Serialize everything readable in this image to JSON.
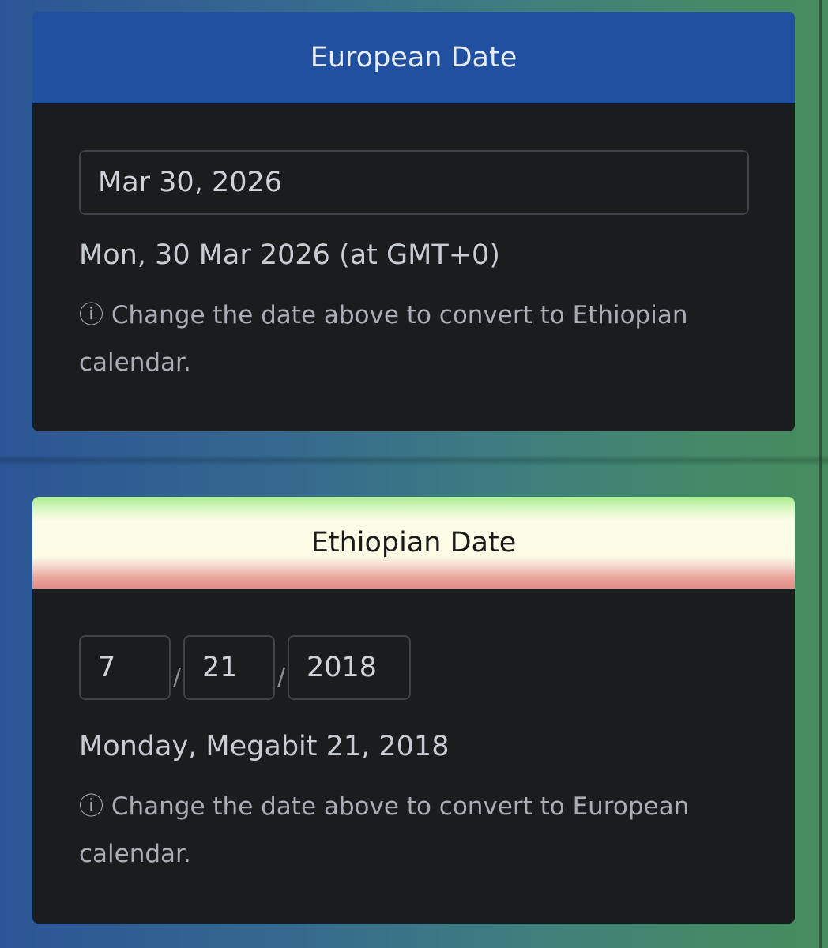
{
  "european": {
    "header": "European Date",
    "input_value": "Mar 30, 2026",
    "readout": "Mon, 30 Mar 2026 (at GMT+0)",
    "hint_icon": "ⓘ",
    "hint": "Change the date above to convert to Ethiopian calendar."
  },
  "ethiopian": {
    "header": "Ethiopian Date",
    "month": "7",
    "day": "21",
    "year": "2018",
    "separator": "/",
    "readout": "Monday, Megabit 21, 2018",
    "hint_icon": "ⓘ",
    "hint": "Change the date above to convert to European calendar."
  },
  "colors": {
    "european_header": "#2150a0",
    "card_body": "#1b1c1e"
  },
  "icons": {
    "hint": "info-icon"
  }
}
